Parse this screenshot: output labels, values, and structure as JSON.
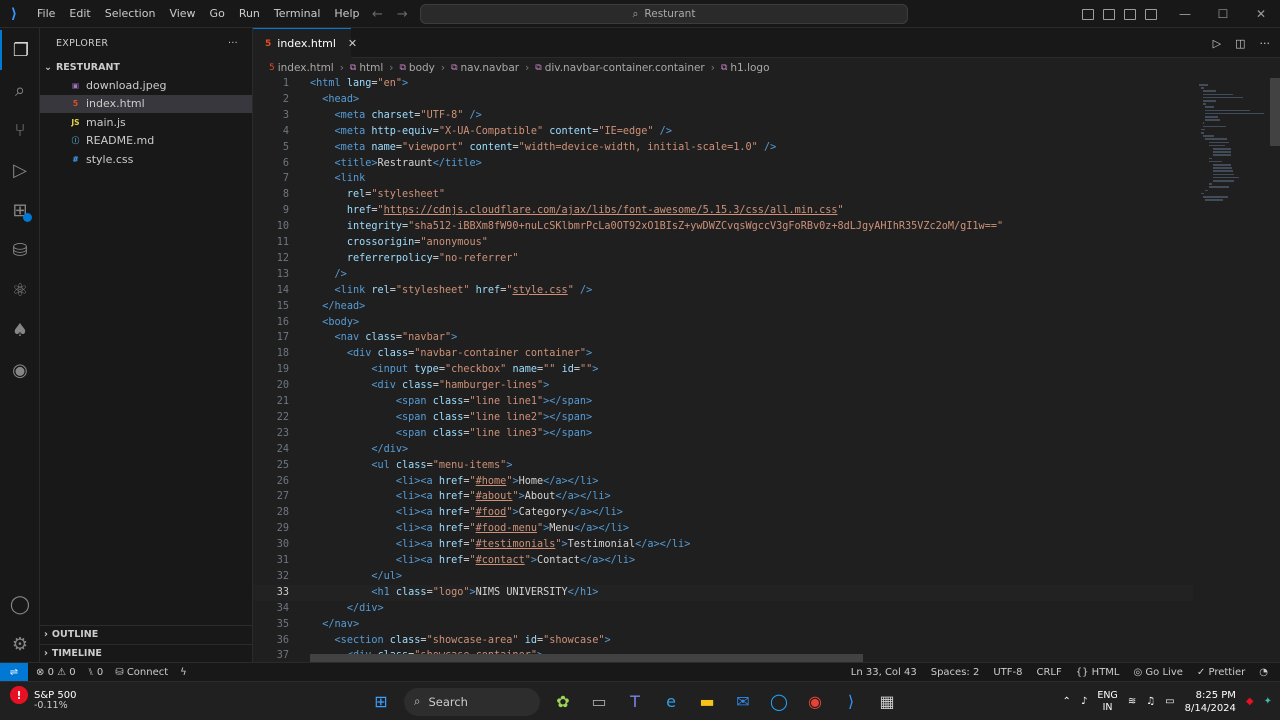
{
  "titlebar": {
    "menu": [
      "File",
      "Edit",
      "Selection",
      "View",
      "Go",
      "Run",
      "Terminal",
      "Help"
    ],
    "search_text": "Resturant"
  },
  "sidebar": {
    "title": "EXPLORER",
    "folder": "RESTURANT",
    "files": [
      {
        "name": "download.jpeg",
        "icon": "image-file-icon"
      },
      {
        "name": "index.html",
        "icon": "html-file-icon"
      },
      {
        "name": "main.js",
        "icon": "js-file-icon"
      },
      {
        "name": "README.md",
        "icon": "markdown-file-icon"
      },
      {
        "name": "style.css",
        "icon": "css-file-icon"
      }
    ],
    "outline": "OUTLINE",
    "timeline": "TIMELINE"
  },
  "editor": {
    "tab_label": "index.html",
    "breadcrumb": [
      "index.html",
      "html",
      "body",
      "nav.navbar",
      "div.navbar-container.container",
      "h1.logo"
    ],
    "current_line": 33,
    "lines": [
      [
        1,
        0,
        [
          [
            "tg",
            "<html "
          ],
          [
            "at",
            "lang"
          ],
          [
            "tx",
            "="
          ],
          [
            "st",
            "\"en\""
          ],
          [
            "tg",
            ">"
          ]
        ]
      ],
      [
        2,
        1,
        [
          [
            "tg",
            "<head>"
          ]
        ]
      ],
      [
        3,
        2,
        [
          [
            "tg",
            "<meta "
          ],
          [
            "at",
            "charset"
          ],
          [
            "tx",
            "="
          ],
          [
            "st",
            "\"UTF-8\""
          ],
          [
            "tg",
            " />"
          ]
        ]
      ],
      [
        4,
        2,
        [
          [
            "tg",
            "<meta "
          ],
          [
            "at",
            "http-equiv"
          ],
          [
            "tx",
            "="
          ],
          [
            "st",
            "\"X-UA-Compatible\""
          ],
          [
            "tx",
            " "
          ],
          [
            "at",
            "content"
          ],
          [
            "tx",
            "="
          ],
          [
            "st",
            "\"IE=edge\""
          ],
          [
            "tg",
            " />"
          ]
        ]
      ],
      [
        5,
        2,
        [
          [
            "tg",
            "<meta "
          ],
          [
            "at",
            "name"
          ],
          [
            "tx",
            "="
          ],
          [
            "st",
            "\"viewport\""
          ],
          [
            "tx",
            " "
          ],
          [
            "at",
            "content"
          ],
          [
            "tx",
            "="
          ],
          [
            "st",
            "\"width=device-width, initial-scale=1.0\""
          ],
          [
            "tg",
            " />"
          ]
        ]
      ],
      [
        6,
        2,
        [
          [
            "tg",
            "<title>"
          ],
          [
            "tx",
            "Restraunt"
          ],
          [
            "tg",
            "</title>"
          ]
        ]
      ],
      [
        7,
        2,
        [
          [
            "tg",
            "<link"
          ]
        ]
      ],
      [
        8,
        3,
        [
          [
            "at",
            "rel"
          ],
          [
            "tx",
            "="
          ],
          [
            "st",
            "\"stylesheet\""
          ]
        ]
      ],
      [
        9,
        3,
        [
          [
            "at",
            "href"
          ],
          [
            "tx",
            "="
          ],
          [
            "st",
            "\""
          ],
          [
            "stu",
            "https://cdnjs.cloudflare.com/ajax/libs/font-awesome/5.15.3/css/all.min.css"
          ],
          [
            "st",
            "\""
          ]
        ]
      ],
      [
        10,
        3,
        [
          [
            "at",
            "integrity"
          ],
          [
            "tx",
            "="
          ],
          [
            "st",
            "\"sha512-iBBXm8fW90+nuLcSKlbmrPcLa0OT92xO1BIsZ+ywDWZCvqsWgccV3gFoRBv0z+8dLJgyAHIhR35VZc2oM/gI1w==\""
          ]
        ]
      ],
      [
        11,
        3,
        [
          [
            "at",
            "crossorigin"
          ],
          [
            "tx",
            "="
          ],
          [
            "st",
            "\"anonymous\""
          ]
        ]
      ],
      [
        12,
        3,
        [
          [
            "at",
            "referrerpolicy"
          ],
          [
            "tx",
            "="
          ],
          [
            "st",
            "\"no-referrer\""
          ]
        ]
      ],
      [
        13,
        2,
        [
          [
            "tg",
            "/>"
          ]
        ]
      ],
      [
        14,
        2,
        [
          [
            "tg",
            "<link "
          ],
          [
            "at",
            "rel"
          ],
          [
            "tx",
            "="
          ],
          [
            "st",
            "\"stylesheet\""
          ],
          [
            "tx",
            " "
          ],
          [
            "at",
            "href"
          ],
          [
            "tx",
            "="
          ],
          [
            "st",
            "\""
          ],
          [
            "stu",
            "style.css"
          ],
          [
            "st",
            "\""
          ],
          [
            "tg",
            " />"
          ]
        ]
      ],
      [
        15,
        1,
        [
          [
            "tg",
            "</head>"
          ]
        ]
      ],
      [
        16,
        1,
        [
          [
            "tg",
            "<body>"
          ]
        ]
      ],
      [
        17,
        2,
        [
          [
            "tg",
            "<nav "
          ],
          [
            "at",
            "class"
          ],
          [
            "tx",
            "="
          ],
          [
            "st",
            "\"navbar\""
          ],
          [
            "tg",
            ">"
          ]
        ]
      ],
      [
        18,
        3,
        [
          [
            "tg",
            "<div "
          ],
          [
            "at",
            "class"
          ],
          [
            "tx",
            "="
          ],
          [
            "st",
            "\"navbar-container container\""
          ],
          [
            "tg",
            ">"
          ]
        ]
      ],
      [
        19,
        5,
        [
          [
            "tg",
            "<input "
          ],
          [
            "at",
            "type"
          ],
          [
            "tx",
            "="
          ],
          [
            "st",
            "\"checkbox\""
          ],
          [
            "tx",
            " "
          ],
          [
            "at",
            "name"
          ],
          [
            "tx",
            "="
          ],
          [
            "st",
            "\"\""
          ],
          [
            "tx",
            " "
          ],
          [
            "at",
            "id"
          ],
          [
            "tx",
            "="
          ],
          [
            "st",
            "\"\""
          ],
          [
            "tg",
            ">"
          ]
        ]
      ],
      [
        20,
        5,
        [
          [
            "tg",
            "<div "
          ],
          [
            "at",
            "class"
          ],
          [
            "tx",
            "="
          ],
          [
            "st",
            "\"hamburger-lines\""
          ],
          [
            "tg",
            ">"
          ]
        ]
      ],
      [
        21,
        7,
        [
          [
            "tg",
            "<span "
          ],
          [
            "at",
            "class"
          ],
          [
            "tx",
            "="
          ],
          [
            "st",
            "\"line line1\""
          ],
          [
            "tg",
            "></span>"
          ]
        ]
      ],
      [
        22,
        7,
        [
          [
            "tg",
            "<span "
          ],
          [
            "at",
            "class"
          ],
          [
            "tx",
            "="
          ],
          [
            "st",
            "\"line line2\""
          ],
          [
            "tg",
            "></span>"
          ]
        ]
      ],
      [
        23,
        7,
        [
          [
            "tg",
            "<span "
          ],
          [
            "at",
            "class"
          ],
          [
            "tx",
            "="
          ],
          [
            "st",
            "\"line line3\""
          ],
          [
            "tg",
            "></span>"
          ]
        ]
      ],
      [
        24,
        5,
        [
          [
            "tg",
            "</div>"
          ]
        ]
      ],
      [
        25,
        5,
        [
          [
            "tg",
            "<ul "
          ],
          [
            "at",
            "class"
          ],
          [
            "tx",
            "="
          ],
          [
            "st",
            "\"menu-items\""
          ],
          [
            "tg",
            ">"
          ]
        ]
      ],
      [
        26,
        7,
        [
          [
            "tg",
            "<li><a "
          ],
          [
            "at",
            "href"
          ],
          [
            "tx",
            "="
          ],
          [
            "st",
            "\""
          ],
          [
            "stu",
            "#home"
          ],
          [
            "st",
            "\""
          ],
          [
            "tg",
            ">"
          ],
          [
            "tx",
            "Home"
          ],
          [
            "tg",
            "</a></li>"
          ]
        ]
      ],
      [
        27,
        7,
        [
          [
            "tg",
            "<li><a "
          ],
          [
            "at",
            "href"
          ],
          [
            "tx",
            "="
          ],
          [
            "st",
            "\""
          ],
          [
            "stu",
            "#about"
          ],
          [
            "st",
            "\""
          ],
          [
            "tg",
            ">"
          ],
          [
            "tx",
            "About"
          ],
          [
            "tg",
            "</a></li>"
          ]
        ]
      ],
      [
        28,
        7,
        [
          [
            "tg",
            "<li><a "
          ],
          [
            "at",
            "href"
          ],
          [
            "tx",
            "="
          ],
          [
            "st",
            "\""
          ],
          [
            "stu",
            "#food"
          ],
          [
            "st",
            "\""
          ],
          [
            "tg",
            ">"
          ],
          [
            "tx",
            "Category"
          ],
          [
            "tg",
            "</a></li>"
          ]
        ]
      ],
      [
        29,
        7,
        [
          [
            "tg",
            "<li><a "
          ],
          [
            "at",
            "href"
          ],
          [
            "tx",
            "="
          ],
          [
            "st",
            "\""
          ],
          [
            "stu",
            "#food-menu"
          ],
          [
            "st",
            "\""
          ],
          [
            "tg",
            ">"
          ],
          [
            "tx",
            "Menu"
          ],
          [
            "tg",
            "</a></li>"
          ]
        ]
      ],
      [
        30,
        7,
        [
          [
            "tg",
            "<li><a "
          ],
          [
            "at",
            "href"
          ],
          [
            "tx",
            "="
          ],
          [
            "st",
            "\""
          ],
          [
            "stu",
            "#testimonials"
          ],
          [
            "st",
            "\""
          ],
          [
            "tg",
            ">"
          ],
          [
            "tx",
            "Testimonial"
          ],
          [
            "tg",
            "</a></li>"
          ]
        ]
      ],
      [
        31,
        7,
        [
          [
            "tg",
            "<li><a "
          ],
          [
            "at",
            "href"
          ],
          [
            "tx",
            "="
          ],
          [
            "st",
            "\""
          ],
          [
            "stu",
            "#contact"
          ],
          [
            "st",
            "\""
          ],
          [
            "tg",
            ">"
          ],
          [
            "tx",
            "Contact"
          ],
          [
            "tg",
            "</a></li>"
          ]
        ]
      ],
      [
        32,
        5,
        [
          [
            "tg",
            "</ul>"
          ]
        ]
      ],
      [
        33,
        5,
        [
          [
            "tg",
            "<h1 "
          ],
          [
            "at",
            "class"
          ],
          [
            "tx",
            "="
          ],
          [
            "st",
            "\"logo\""
          ],
          [
            "tg",
            ">"
          ],
          [
            "tx",
            "NIMS UNIVERSITY"
          ],
          [
            "tg",
            "</h1>"
          ]
        ]
      ],
      [
        34,
        3,
        [
          [
            "tg",
            "</div>"
          ]
        ]
      ],
      [
        35,
        1,
        [
          [
            "tg",
            "</nav>"
          ]
        ]
      ],
      [
        36,
        2,
        [
          [
            "tg",
            "<section "
          ],
          [
            "at",
            "class"
          ],
          [
            "tx",
            "="
          ],
          [
            "st",
            "\"showcase-area\""
          ],
          [
            "tx",
            " "
          ],
          [
            "at",
            "id"
          ],
          [
            "tx",
            "="
          ],
          [
            "st",
            "\"showcase\""
          ],
          [
            "tg",
            ">"
          ]
        ]
      ],
      [
        37,
        3,
        [
          [
            "tg",
            "<div "
          ],
          [
            "at",
            "class"
          ],
          [
            "tx",
            "="
          ],
          [
            "st",
            "\"showcase-container\""
          ],
          [
            "tg",
            ">"
          ]
        ]
      ]
    ]
  },
  "statusbar": {
    "errors": "0",
    "warnings": "0",
    "ports": "0",
    "connect": "Connect",
    "position": "Ln 33, Col 43",
    "spaces": "Spaces: 2",
    "encoding": "UTF-8",
    "eol": "CRLF",
    "language": "HTML",
    "golive": "Go Live",
    "prettier": "Prettier"
  },
  "taskbar": {
    "stock_name": "S&P 500",
    "stock_change": "-0.11%",
    "search_label": "Search",
    "lang_top": "ENG",
    "lang_bottom": "IN",
    "time": "8:25 PM",
    "date": "8/14/2024"
  },
  "colors": {
    "accent": "#0078d4",
    "html_icon": "#e44d26",
    "js_icon": "#e8d44d",
    "md_icon": "#519aba",
    "css_icon": "#42a5f5"
  }
}
